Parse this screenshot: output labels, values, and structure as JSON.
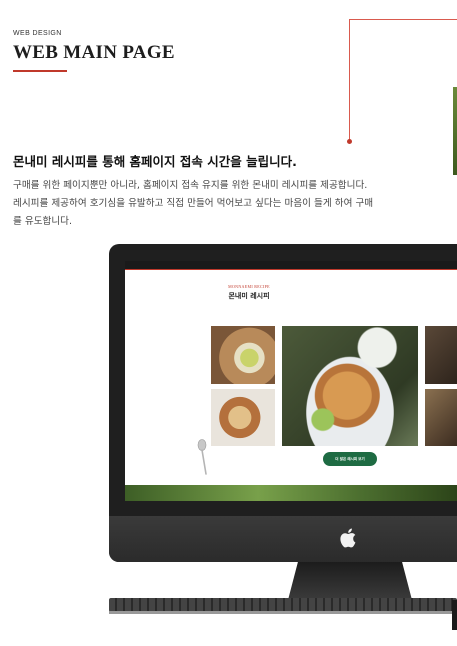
{
  "header": {
    "kicker": "WEB DESIGN",
    "title": "WEB MAIN PAGE"
  },
  "intro": {
    "headline": "몬내미 레시피를 통해 홈페이지 접속 시간을 늘립니다.",
    "lines": [
      "구매를 위한 페이지뿐만 아니라,  홈페이지 접속 유지를 위한 몬내미 레시피를 제공합니다.",
      "레시피를 제공하여 호기심을 유발하고 직접 만들어 먹어보고 싶다는 마음이 들게 하여 구매",
      "를 유도합니다."
    ]
  },
  "mockup": {
    "kicker": "MONNAEMI RECIPE",
    "title": "몬내미 레시피",
    "button_label": "더 많은 레시피 보기"
  },
  "colors": {
    "accent": "#c0392b",
    "button_green": "#1e6b43"
  },
  "icons": [
    "apple-logo-icon",
    "spoon-icon"
  ]
}
